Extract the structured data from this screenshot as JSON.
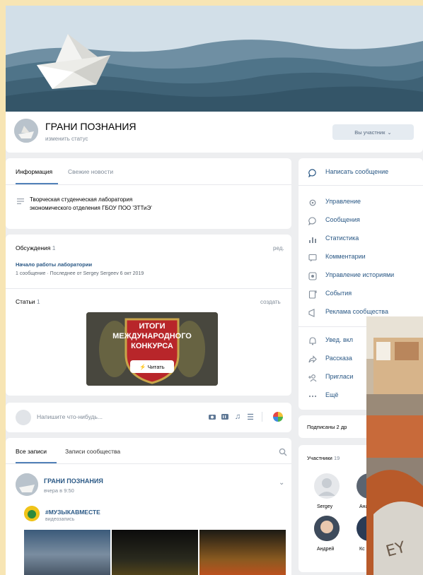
{
  "group": {
    "name": "ГРАНИ ПОЗНАНИЯ",
    "status_link": "изменить статус",
    "member_button": "Вы участник"
  },
  "info_card": {
    "tabs": [
      "Информация",
      "Свежие новости"
    ],
    "description_line1": "Творческая студенческая лаборатория",
    "description_line2": "экономического отделения ГБОУ ПОО 'ЗТТиЭ'"
  },
  "discussions": {
    "label": "Обсуждения",
    "count": "1",
    "edit_link": "ред.",
    "topic_title": "Начало работы лаборатории",
    "topic_meta": "1 сообщение · Последнее от Sergey Sergeev 6 окт 2019"
  },
  "articles": {
    "label": "Статьи",
    "count": "1",
    "create_link": "создать",
    "banner_line1": "ИТОГИ",
    "banner_line2": "МЕЖДУНАРОДНОГО",
    "banner_line3": "КОНКУРСА",
    "read_button": "Читать"
  },
  "composer": {
    "placeholder": "Напишите что-нибудь..."
  },
  "wall": {
    "tabs": [
      "Все записи",
      "Записи сообщества"
    ],
    "post_author": "ГРАНИ ПОЗНАНИЯ",
    "post_time": "вчера в 9:50",
    "repost_title": "#МУЗЫКАВМЕСТЕ",
    "repost_subtitle": "видеозапись"
  },
  "sidebar": {
    "write_message": "Написать сообщение",
    "menu": [
      {
        "label": "Управление",
        "icon": "gear-icon"
      },
      {
        "label": "Сообщения",
        "icon": "message-icon"
      },
      {
        "label": "Статистика",
        "icon": "stats-icon"
      },
      {
        "label": "Комментарии",
        "icon": "comment-icon"
      },
      {
        "label": "Управление историями",
        "icon": "stories-icon"
      },
      {
        "label": "События",
        "icon": "events-icon"
      },
      {
        "label": "Реклама сообщества",
        "icon": "ads-icon"
      }
    ],
    "menu2": [
      {
        "label": "Увед. вкл",
        "icon": "bell-icon"
      },
      {
        "label": "Рассказа",
        "icon": "share-icon"
      },
      {
        "label": "Пригласи",
        "icon": "invite-icon"
      },
      {
        "label": "Ещё",
        "icon": "more-icon"
      }
    ],
    "subscribed_label": "Подписаны 2 др",
    "members_label": "Участники",
    "members_count": "19",
    "members": [
      "Sergey",
      "Анас",
      "Андрей",
      "Кс"
    ]
  },
  "colors": {
    "accent": "#5181b8",
    "link": "#2a5885",
    "border": "#f7e5b4"
  }
}
